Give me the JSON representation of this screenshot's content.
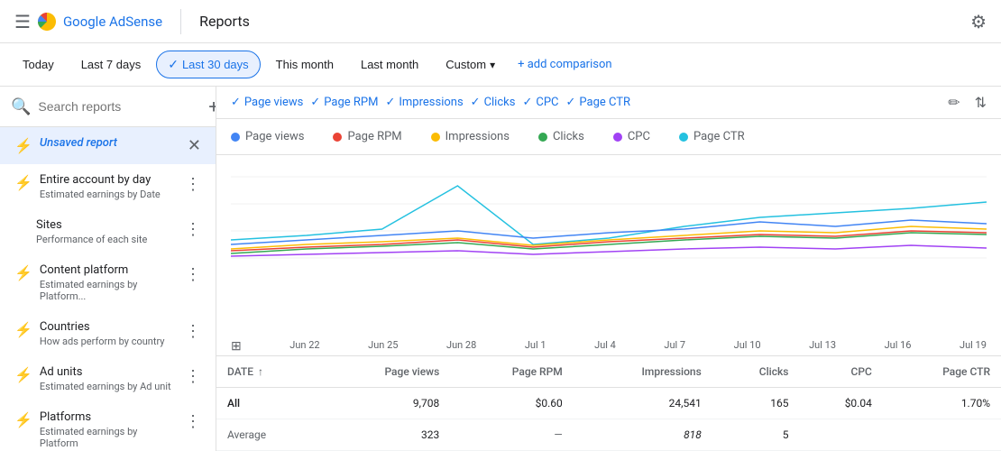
{
  "topbar": {
    "brand": "Google AdSense",
    "divider": true,
    "title": "Reports",
    "gear_label": "⚙"
  },
  "filterbar": {
    "buttons": [
      {
        "label": "Today",
        "active": false
      },
      {
        "label": "Last 7 days",
        "active": false
      },
      {
        "label": "Last 30 days",
        "active": true
      },
      {
        "label": "This month",
        "active": false
      },
      {
        "label": "Last month",
        "active": false
      },
      {
        "label": "Custom",
        "active": false,
        "has_arrow": true
      }
    ],
    "add_comparison": "+ add comparison"
  },
  "sidebar": {
    "search_placeholder": "Search reports",
    "items": [
      {
        "id": "unsaved",
        "title": "Unsaved report",
        "sub": "",
        "active": true,
        "closable": true,
        "has_icon": true
      },
      {
        "id": "entire-account",
        "title": "Entire account by day",
        "sub": "Estimated earnings by Date",
        "active": false,
        "has_menu": true,
        "has_icon": true
      },
      {
        "id": "sites",
        "title": "Sites",
        "sub": "Performance of each site",
        "active": false,
        "has_menu": true,
        "has_icon": false
      },
      {
        "id": "content-platform",
        "title": "Content platform",
        "sub": "Estimated earnings by Platform...",
        "active": false,
        "has_menu": true,
        "has_icon": true
      },
      {
        "id": "countries",
        "title": "Countries",
        "sub": "How ads perform by country",
        "active": false,
        "has_menu": true,
        "has_icon": true
      },
      {
        "id": "ad-units",
        "title": "Ad units",
        "sub": "Estimated earnings by Ad unit",
        "active": false,
        "has_menu": true,
        "has_icon": true
      },
      {
        "id": "platforms",
        "title": "Platforms",
        "sub": "Estimated earnings by Platform",
        "active": false,
        "has_menu": true,
        "has_icon": true
      }
    ]
  },
  "chips": [
    {
      "label": "Page views",
      "checked": true
    },
    {
      "label": "Page RPM",
      "checked": true
    },
    {
      "label": "Impressions",
      "checked": true
    },
    {
      "label": "Clicks",
      "checked": true
    },
    {
      "label": "CPC",
      "checked": true
    },
    {
      "label": "Page CTR",
      "checked": true
    }
  ],
  "legend": [
    {
      "label": "Page views",
      "color": "#4285f4"
    },
    {
      "label": "Page RPM",
      "color": "#ea4335"
    },
    {
      "label": "Impressions",
      "color": "#fbbc04"
    },
    {
      "label": "Clicks",
      "color": "#34a853"
    },
    {
      "label": "CPC",
      "color": "#a142f4"
    },
    {
      "label": "Page CTR",
      "color": "#24c1e0"
    }
  ],
  "xaxis": [
    "Jun 22",
    "Jun 25",
    "Jun 28",
    "Jul 1",
    "Jul 4",
    "Jul 7",
    "Jul 10",
    "Jul 13",
    "Jul 16",
    "Jul 19"
  ],
  "table": {
    "columns": [
      "DATE",
      "Page views",
      "Page RPM",
      "Impressions",
      "Clicks",
      "CPC",
      "Page CTR"
    ],
    "rows": [
      {
        "date": "All",
        "page_views": "9,708",
        "page_rpm": "$0.60",
        "impressions": "24,541",
        "clicks": "165",
        "cpc": "$0.04",
        "page_ctr": "1.70%"
      },
      {
        "date": "Average",
        "page_views": "323",
        "page_rpm": "—",
        "impressions": "818",
        "clicks": "5",
        "cpc": "",
        "page_ctr": ""
      }
    ]
  }
}
